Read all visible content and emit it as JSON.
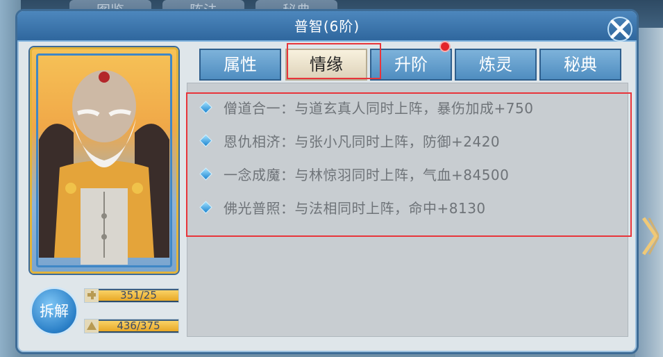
{
  "background": {
    "tabs": [
      "图鉴",
      "阵法",
      "秘典"
    ]
  },
  "window": {
    "title": "普智(6阶)"
  },
  "tabs": [
    {
      "label": "属性"
    },
    {
      "label": "情缘"
    },
    {
      "label": "升阶"
    },
    {
      "label": "炼灵"
    },
    {
      "label": "秘典"
    }
  ],
  "active_tab": "情缘",
  "notification_on": "升阶",
  "fate_bonds": [
    {
      "text": "僧道合一：与道玄真人同时上阵，暴伤加成+750"
    },
    {
      "text": "恩仇相济：与张小凡同时上阵，防御+2420"
    },
    {
      "text": "一念成魔：与林惊羽同时上阵，气血+84500"
    },
    {
      "text": "佛光普照：与法相同时上阵，命中+8130"
    }
  ],
  "dismantle_button": "拆解",
  "stats": [
    {
      "icon": "fragment-icon",
      "value": "351/25",
      "fill": 1.0
    },
    {
      "icon": "star-up-icon",
      "value": "436/375",
      "fill": 1.0
    }
  ],
  "colors": {
    "title_bar": "#2f679e",
    "tab_blue": "#5b9bd0",
    "active_tab": "#efe6cf",
    "highlight": "#e8343a",
    "bar_fill": "#f0b83a"
  }
}
